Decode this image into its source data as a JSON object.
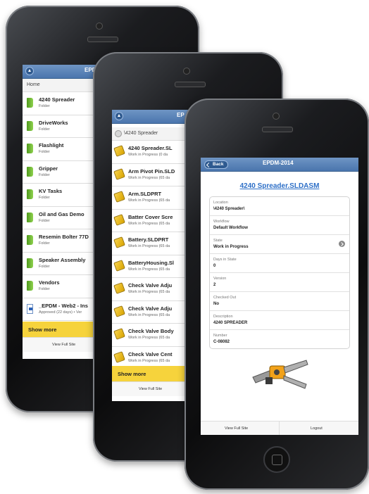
{
  "phone1": {
    "header_title": "EPDM",
    "breadcrumb": "Home",
    "items": [
      {
        "name": "4240 Spreader",
        "sub": "Folder",
        "icon": "folder-icon"
      },
      {
        "name": "DriveWorks",
        "sub": "Folder",
        "icon": "folder-icon"
      },
      {
        "name": "Flashlight",
        "sub": "Folder",
        "icon": "folder-icon"
      },
      {
        "name": "Gripper",
        "sub": "Folder",
        "icon": "folder-icon"
      },
      {
        "name": "KV Tasks",
        "sub": "Folder",
        "icon": "folder-icon"
      },
      {
        "name": "Oil and Gas Demo",
        "sub": "Folder",
        "icon": "folder-icon"
      },
      {
        "name": "Resemin Bolter 77D",
        "sub": "Folder",
        "icon": "folder-icon"
      },
      {
        "name": "Speaker Assembly",
        "sub": "Folder",
        "icon": "folder-icon"
      },
      {
        "name": "Vendors",
        "sub": "Folder",
        "icon": "folder-icon"
      },
      {
        "name": "_EPDM - Web2 - Ins",
        "sub": "Approved (22 days) • Ver",
        "icon": "word-document-icon"
      }
    ],
    "show_more": "Show more",
    "footer_left": "View Full Site"
  },
  "phone2": {
    "header_title": "EP",
    "breadcrumb": "\\4240 Spreader",
    "items": [
      {
        "name": "4240 Spreader.SL",
        "sub": "Work in Progress (0 da"
      },
      {
        "name": "Arm Pivot Pin.SLD",
        "sub": "Work in Progress (65 da"
      },
      {
        "name": "Arm.SLDPRT",
        "sub": "Work in Progress (65 da"
      },
      {
        "name": "Batter Cover Scre",
        "sub": "Work in Progress (65 da"
      },
      {
        "name": "Battery.SLDPRT",
        "sub": "Work in Progress (65 da"
      },
      {
        "name": "BatteryHousing.Sl",
        "sub": "Work in Progress (65 da"
      },
      {
        "name": "Check Valve Adju",
        "sub": "Work in Progress (65 da"
      },
      {
        "name": "Check Valve Adju",
        "sub": "Work in Progress (65 da"
      },
      {
        "name": "Check Valve Body",
        "sub": "Work in Progress (65 da"
      },
      {
        "name": "Check Valve Cent",
        "sub": "Work in Progress (65 da"
      }
    ],
    "show_more": "Show more",
    "footer_left": "View Full Site"
  },
  "phone3": {
    "back_label": "Back",
    "header_title": "EPDM-2014",
    "file_title": "4240 Spreader.SLDASM",
    "properties": [
      {
        "label": "Location",
        "value": "\\4240 Spreader\\"
      },
      {
        "label": "Workflow",
        "value": "Default Workflow"
      },
      {
        "label": "State",
        "value": "Work in Progress"
      },
      {
        "label": "Days in State",
        "value": "0"
      },
      {
        "label": "Version",
        "value": "2"
      },
      {
        "label": "Checked Out",
        "value": "No"
      },
      {
        "label": "Description",
        "value": "4240 SPREADER"
      },
      {
        "label": "Number",
        "value": "C-08082"
      }
    ],
    "footer_left": "View Full Site",
    "footer_right": "Logout"
  }
}
